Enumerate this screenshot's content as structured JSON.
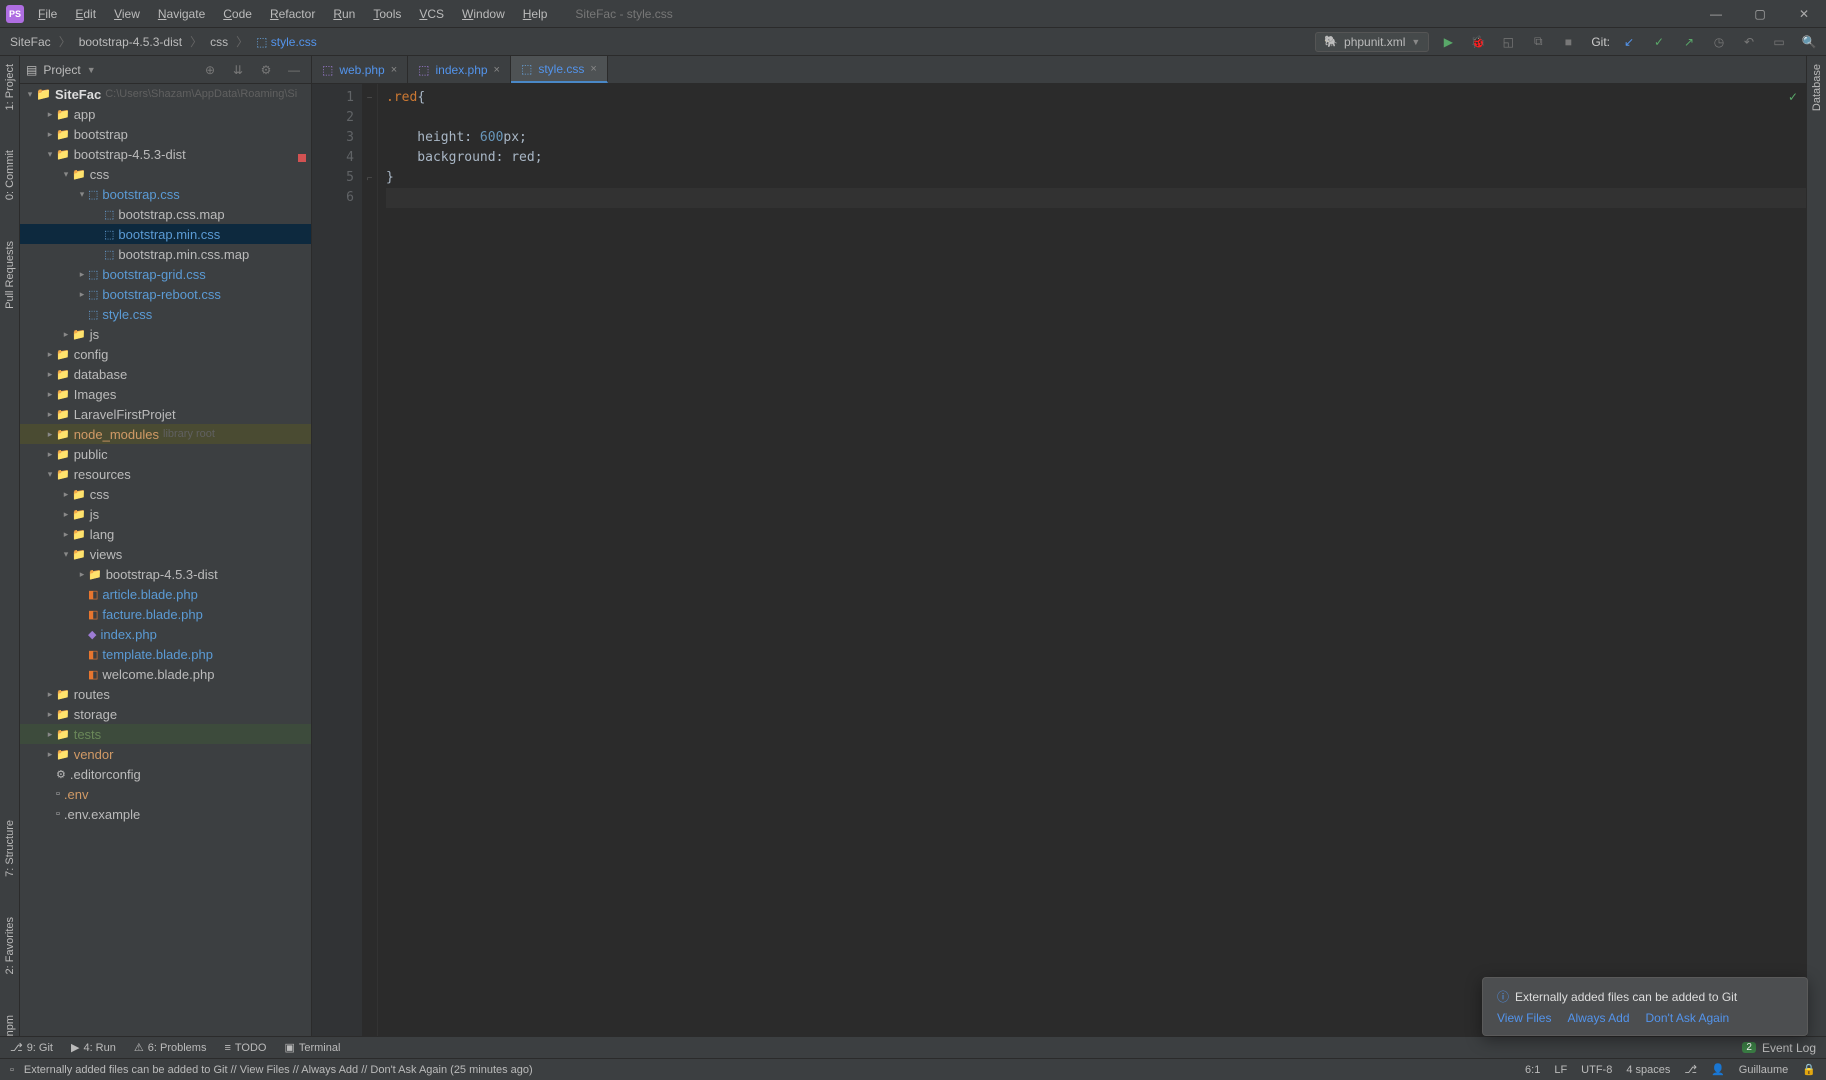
{
  "app": {
    "icon_text": "PS",
    "title": "SiteFac - style.css"
  },
  "menu": [
    "File",
    "Edit",
    "View",
    "Navigate",
    "Code",
    "Refactor",
    "Run",
    "Tools",
    "VCS",
    "Window",
    "Help"
  ],
  "window_controls": {
    "min": "—",
    "max": "▢",
    "close": "✕"
  },
  "breadcrumb": [
    "SiteFac",
    "bootstrap-4.5.3-dist",
    "css",
    "style.css"
  ],
  "toolbar": {
    "run_config": "phpunit.xml",
    "git_label": "Git:"
  },
  "left_strip": [
    "1: Project",
    "0: Commit",
    "Pull Requests"
  ],
  "left_strip_lower": [
    "7: Structure",
    "2: Favorites",
    "npm"
  ],
  "right_strip": [
    "Database"
  ],
  "project_panel": {
    "title": "Project",
    "root": {
      "name": "SiteFac",
      "path": "C:\\Users\\Shazam\\AppData\\Roaming\\Si"
    },
    "tree": [
      {
        "d": 1,
        "arrow": ">",
        "icon": "folder",
        "label": "app",
        "cls": ""
      },
      {
        "d": 1,
        "arrow": ">",
        "icon": "folder",
        "label": "bootstrap",
        "cls": ""
      },
      {
        "d": 1,
        "arrow": "v",
        "icon": "folder",
        "label": "bootstrap-4.5.3-dist",
        "cls": ""
      },
      {
        "d": 2,
        "arrow": "v",
        "icon": "folder",
        "label": "css",
        "cls": ""
      },
      {
        "d": 3,
        "arrow": "v",
        "icon": "css",
        "label": "bootstrap.css",
        "cls": "blue"
      },
      {
        "d": 4,
        "arrow": "",
        "icon": "css",
        "label": "bootstrap.css.map",
        "cls": ""
      },
      {
        "d": 4,
        "arrow": "",
        "icon": "css",
        "label": "bootstrap.min.css",
        "cls": "blue",
        "row": "selected"
      },
      {
        "d": 4,
        "arrow": "",
        "icon": "css",
        "label": "bootstrap.min.css.map",
        "cls": ""
      },
      {
        "d": 3,
        "arrow": ">",
        "icon": "css",
        "label": "bootstrap-grid.css",
        "cls": "blue"
      },
      {
        "d": 3,
        "arrow": ">",
        "icon": "css",
        "label": "bootstrap-reboot.css",
        "cls": "blue"
      },
      {
        "d": 3,
        "arrow": "",
        "icon": "css",
        "label": "style.css",
        "cls": "blue"
      },
      {
        "d": 2,
        "arrow": ">",
        "icon": "folder",
        "label": "js",
        "cls": ""
      },
      {
        "d": 1,
        "arrow": ">",
        "icon": "folder",
        "label": "config",
        "cls": ""
      },
      {
        "d": 1,
        "arrow": ">",
        "icon": "folder",
        "label": "database",
        "cls": ""
      },
      {
        "d": 1,
        "arrow": ">",
        "icon": "folder",
        "label": "Images",
        "cls": ""
      },
      {
        "d": 1,
        "arrow": ">",
        "icon": "folder",
        "label": "LaravelFirstProjet",
        "cls": ""
      },
      {
        "d": 1,
        "arrow": ">",
        "icon": "folder",
        "label": "node_modules",
        "cls": "darkorange",
        "extra": "library root",
        "row": "highlighted"
      },
      {
        "d": 1,
        "arrow": ">",
        "icon": "folder",
        "label": "public",
        "cls": ""
      },
      {
        "d": 1,
        "arrow": "v",
        "icon": "folder",
        "label": "resources",
        "cls": ""
      },
      {
        "d": 2,
        "arrow": ">",
        "icon": "folder",
        "label": "css",
        "cls": ""
      },
      {
        "d": 2,
        "arrow": ">",
        "icon": "folder",
        "label": "js",
        "cls": ""
      },
      {
        "d": 2,
        "arrow": ">",
        "icon": "folder",
        "label": "lang",
        "cls": ""
      },
      {
        "d": 2,
        "arrow": "v",
        "icon": "folder",
        "label": "views",
        "cls": ""
      },
      {
        "d": 3,
        "arrow": ">",
        "icon": "folder",
        "label": "bootstrap-4.5.3-dist",
        "cls": ""
      },
      {
        "d": 3,
        "arrow": "",
        "icon": "blade",
        "label": "article.blade.php",
        "cls": "blue"
      },
      {
        "d": 3,
        "arrow": "",
        "icon": "blade",
        "label": "facture.blade.php",
        "cls": "blue"
      },
      {
        "d": 3,
        "arrow": "",
        "icon": "php",
        "label": "index.php",
        "cls": "blue"
      },
      {
        "d": 3,
        "arrow": "",
        "icon": "blade",
        "label": "template.blade.php",
        "cls": "blue"
      },
      {
        "d": 3,
        "arrow": "",
        "icon": "blade",
        "label": "welcome.blade.php",
        "cls": ""
      },
      {
        "d": 1,
        "arrow": ">",
        "icon": "folder",
        "label": "routes",
        "cls": ""
      },
      {
        "d": 1,
        "arrow": ">",
        "icon": "folder",
        "label": "storage",
        "cls": ""
      },
      {
        "d": 1,
        "arrow": ">",
        "icon": "folder",
        "label": "tests",
        "cls": "green",
        "row": "vcs-highlight"
      },
      {
        "d": 1,
        "arrow": ">",
        "icon": "folder",
        "label": "vendor",
        "cls": "darkorange"
      },
      {
        "d": 1,
        "arrow": "",
        "icon": "gear",
        "label": ".editorconfig",
        "cls": ""
      },
      {
        "d": 1,
        "arrow": "",
        "icon": "file",
        "label": ".env",
        "cls": "darkorange"
      },
      {
        "d": 1,
        "arrow": "",
        "icon": "file",
        "label": ".env.example",
        "cls": ""
      }
    ]
  },
  "tabs": [
    {
      "label": "web.php",
      "icon": "php",
      "active": false
    },
    {
      "label": "index.php",
      "icon": "php",
      "active": false
    },
    {
      "label": "style.css",
      "icon": "css",
      "active": true
    }
  ],
  "code": {
    "lines": [
      {
        "n": 1,
        "tokens": [
          {
            "t": ".red",
            "c": "sel"
          },
          {
            "t": "{",
            "c": "brace"
          }
        ],
        "fold": "−"
      },
      {
        "n": 2,
        "tokens": []
      },
      {
        "n": 3,
        "tokens": [
          {
            "t": "    height: ",
            "c": "prop"
          },
          {
            "t": "600",
            "c": "num"
          },
          {
            "t": "px;",
            "c": "prop"
          }
        ]
      },
      {
        "n": 4,
        "tokens": [
          {
            "t": "    background: ",
            "c": "prop"
          },
          {
            "t": "red",
            "c": "prop"
          },
          {
            "t": ";",
            "c": "prop"
          }
        ],
        "marker": "red"
      },
      {
        "n": 5,
        "tokens": [
          {
            "t": "}",
            "c": "brace"
          }
        ],
        "fold": "⌐"
      },
      {
        "n": 6,
        "tokens": [],
        "current": true
      }
    ]
  },
  "popup": {
    "title": "Externally added files can be added to Git",
    "links": [
      "View Files",
      "Always Add",
      "Don't Ask Again"
    ]
  },
  "bottom_tabs": [
    {
      "icon": "branch",
      "label": "9: Git"
    },
    {
      "icon": "play",
      "label": "4: Run"
    },
    {
      "icon": "warn",
      "label": "6: Problems"
    },
    {
      "icon": "todo",
      "label": "TODO"
    },
    {
      "icon": "term",
      "label": "Terminal"
    }
  ],
  "bottom_right": {
    "badge": "2",
    "label": "Event Log"
  },
  "statusbar": {
    "msg": "Externally added files can be added to Git // View Files // Always Add // Don't Ask Again (25 minutes ago)",
    "pos": "6:1",
    "enc": "LF",
    "charset": "UTF-8",
    "indent": "4 spaces",
    "branch_icon": "⎇",
    "user": "Guillaume"
  }
}
